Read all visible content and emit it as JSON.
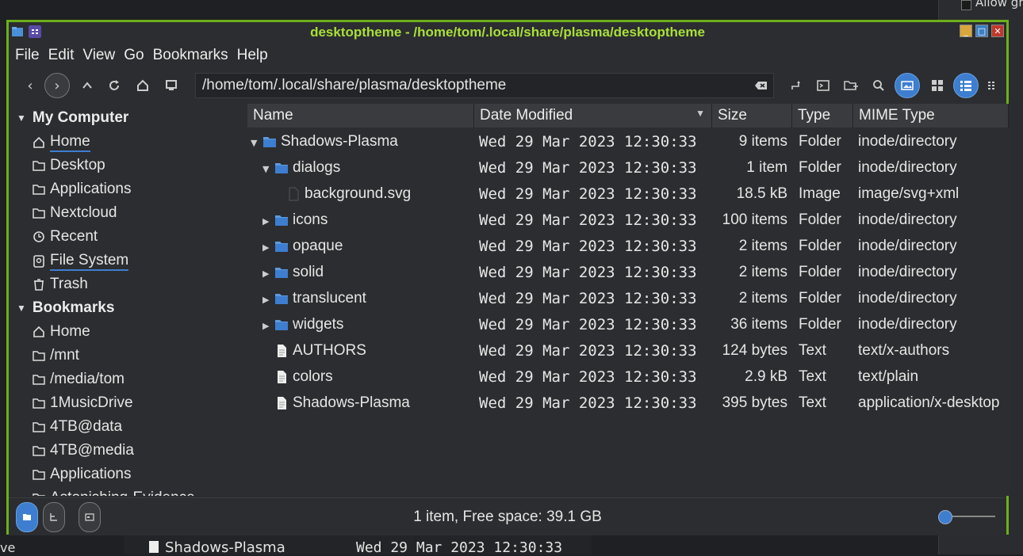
{
  "window": {
    "title": "desktoptheme - /home/tom/.local/share/plasma/desktoptheme"
  },
  "menu": [
    "File",
    "Edit",
    "View",
    "Go",
    "Bookmarks",
    "Help"
  ],
  "location": {
    "path": "/home/tom/.local/share/plasma/desktoptheme"
  },
  "sidebar": {
    "my_computer": {
      "label": "My Computer",
      "items": [
        {
          "label": "Home",
          "icon": "home-icon"
        },
        {
          "label": "Desktop",
          "icon": "folder-icon"
        },
        {
          "label": "Applications",
          "icon": "folder-icon"
        },
        {
          "label": "Nextcloud",
          "icon": "folder-icon"
        },
        {
          "label": "Recent",
          "icon": "clock-icon"
        },
        {
          "label": "File System",
          "icon": "drive-icon"
        },
        {
          "label": "Trash",
          "icon": "trash-icon"
        }
      ]
    },
    "bookmarks": {
      "label": "Bookmarks",
      "items": [
        {
          "label": "Home",
          "icon": "home-icon"
        },
        {
          "label": "/mnt",
          "icon": "folder-icon"
        },
        {
          "label": "/media/tom",
          "icon": "folder-icon"
        },
        {
          "label": "1MusicDrive",
          "icon": "folder-icon"
        },
        {
          "label": "4TB@data",
          "icon": "folder-icon"
        },
        {
          "label": "4TB@media",
          "icon": "folder-icon"
        },
        {
          "label": "Applications",
          "icon": "folder-icon"
        },
        {
          "label": "Astonishing-Evidence-",
          "icon": "folder-icon"
        }
      ]
    }
  },
  "columns": {
    "name": "Name",
    "date": "Date Modified",
    "size": "Size",
    "type": "Type",
    "mime": "MIME Type"
  },
  "files": [
    {
      "name": "Shadows-Plasma",
      "date": "Wed 29 Mar 2023 12:30:33",
      "size": "9 items",
      "type": "Folder",
      "mime": "inode/directory",
      "kind": "folder",
      "expander": "open"
    },
    {
      "name": "dialogs",
      "date": "Wed 29 Mar 2023 12:30:33",
      "size": "1 item",
      "type": "Folder",
      "mime": "inode/directory",
      "kind": "folder",
      "expander": "open"
    },
    {
      "name": "background.svg",
      "date": "Wed 29 Mar 2023 12:30:33",
      "size": "18.5 kB",
      "type": "Image",
      "mime": "image/svg+xml",
      "kind": "image",
      "expander": "none"
    },
    {
      "name": "icons",
      "date": "Wed 29 Mar 2023 12:30:33",
      "size": "100 items",
      "type": "Folder",
      "mime": "inode/directory",
      "kind": "folder",
      "expander": "closed"
    },
    {
      "name": "opaque",
      "date": "Wed 29 Mar 2023 12:30:33",
      "size": "2 items",
      "type": "Folder",
      "mime": "inode/directory",
      "kind": "folder",
      "expander": "closed"
    },
    {
      "name": "solid",
      "date": "Wed 29 Mar 2023 12:30:33",
      "size": "2 items",
      "type": "Folder",
      "mime": "inode/directory",
      "kind": "folder",
      "expander": "closed"
    },
    {
      "name": "translucent",
      "date": "Wed 29 Mar 2023 12:30:33",
      "size": "2 items",
      "type": "Folder",
      "mime": "inode/directory",
      "kind": "folder",
      "expander": "closed"
    },
    {
      "name": "widgets",
      "date": "Wed 29 Mar 2023 12:30:33",
      "size": "36 items",
      "type": "Folder",
      "mime": "inode/directory",
      "kind": "folder",
      "expander": "closed"
    },
    {
      "name": "AUTHORS",
      "date": "Wed 29 Mar 2023 12:30:33",
      "size": "124 bytes",
      "type": "Text",
      "mime": "text/x-authors",
      "kind": "text",
      "expander": "none"
    },
    {
      "name": "colors",
      "date": "Wed 29 Mar 2023 12:30:33",
      "size": "2.9 kB",
      "type": "Text",
      "mime": "text/plain",
      "kind": "text",
      "expander": "none"
    },
    {
      "name": "Shadows-Plasma",
      "date": "Wed 29 Mar 2023 12:30:33",
      "size": "395 bytes",
      "type": "Text",
      "mime": "application/x-desktop",
      "kind": "text",
      "expander": "none"
    }
  ],
  "status": {
    "text": "1 item, Free space: 39.1 GB"
  },
  "background": {
    "right_peek": "Allow gr",
    "bottom_name": "Shadows-Plasma",
    "bottom_date": "Wed 29 Mar 2023 12:30:33",
    "left_peek": "ve"
  },
  "colors": {
    "frame": "#6bb01a",
    "title": "#a8e03a",
    "accent": "#3d7ed0"
  }
}
